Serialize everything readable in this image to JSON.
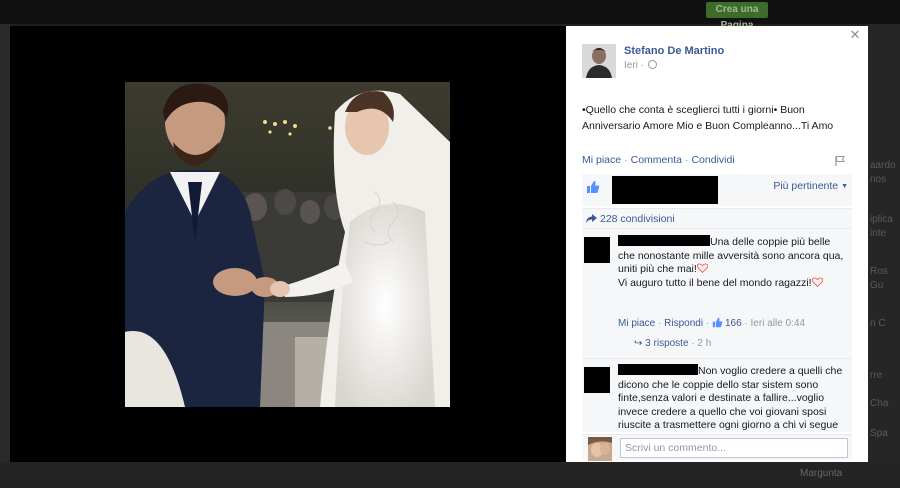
{
  "background": {
    "create_page_label": "Crea una Pagina",
    "right_column": [
      "aardo",
      "nos",
      "",
      "iplica",
      "inte",
      "Ros",
      "Gu",
      "n C",
      "rre",
      "Cha",
      "Spa"
    ],
    "bottom_item": "Margunta"
  },
  "post": {
    "author": "Stefano De Martino",
    "time": "Ieri",
    "text": "•Quello che conta è sceglierci tutti i giorni• Buon Anniversario Amore Mio e Buon Compleanno...Ti Amo",
    "actions": {
      "like": "Mi piace",
      "comment": "Commenta",
      "share": "Condividi"
    },
    "sort_label": "Più pertinente",
    "shares": "228 condivisioni"
  },
  "comments": [
    {
      "text": "Una delle coppie più belle che nonostante mille avversità sono ancora qua, uniti più che mai!",
      "text2": "Vi auguro tutto il bene del mondo ragazzi!",
      "like": "Mi piace",
      "reply": "Rispondi",
      "like_count": "166",
      "time": "Ieri alle 0:44",
      "replies": "3 risposte",
      "replies_time": "2 h"
    },
    {
      "text": "Non voglio credere a quelli che dicono che le coppie dello star sistem sono finte,senza valori e destinate a fallire...voglio invece credere a quello che voi giovani sposi riuscite a trasmettere ogni giorno a chi vi segue con affetto e cioè amore e famiglia.amatevi sempre così come vi vediamo...fatelo soprattutto"
    }
  ],
  "write_comment": {
    "placeholder": "Scrivi un commento..."
  },
  "icons": {
    "close": "close-icon",
    "privacy": "globe-icon",
    "report": "flag-icon",
    "like": "thumbs-up-icon",
    "share": "share-icon",
    "heart": "heart-icon"
  },
  "colors": {
    "link": "#3b5998",
    "meta": "#9197a3",
    "panel_bg": "#f6f7f9",
    "lightbox": "#000000"
  }
}
